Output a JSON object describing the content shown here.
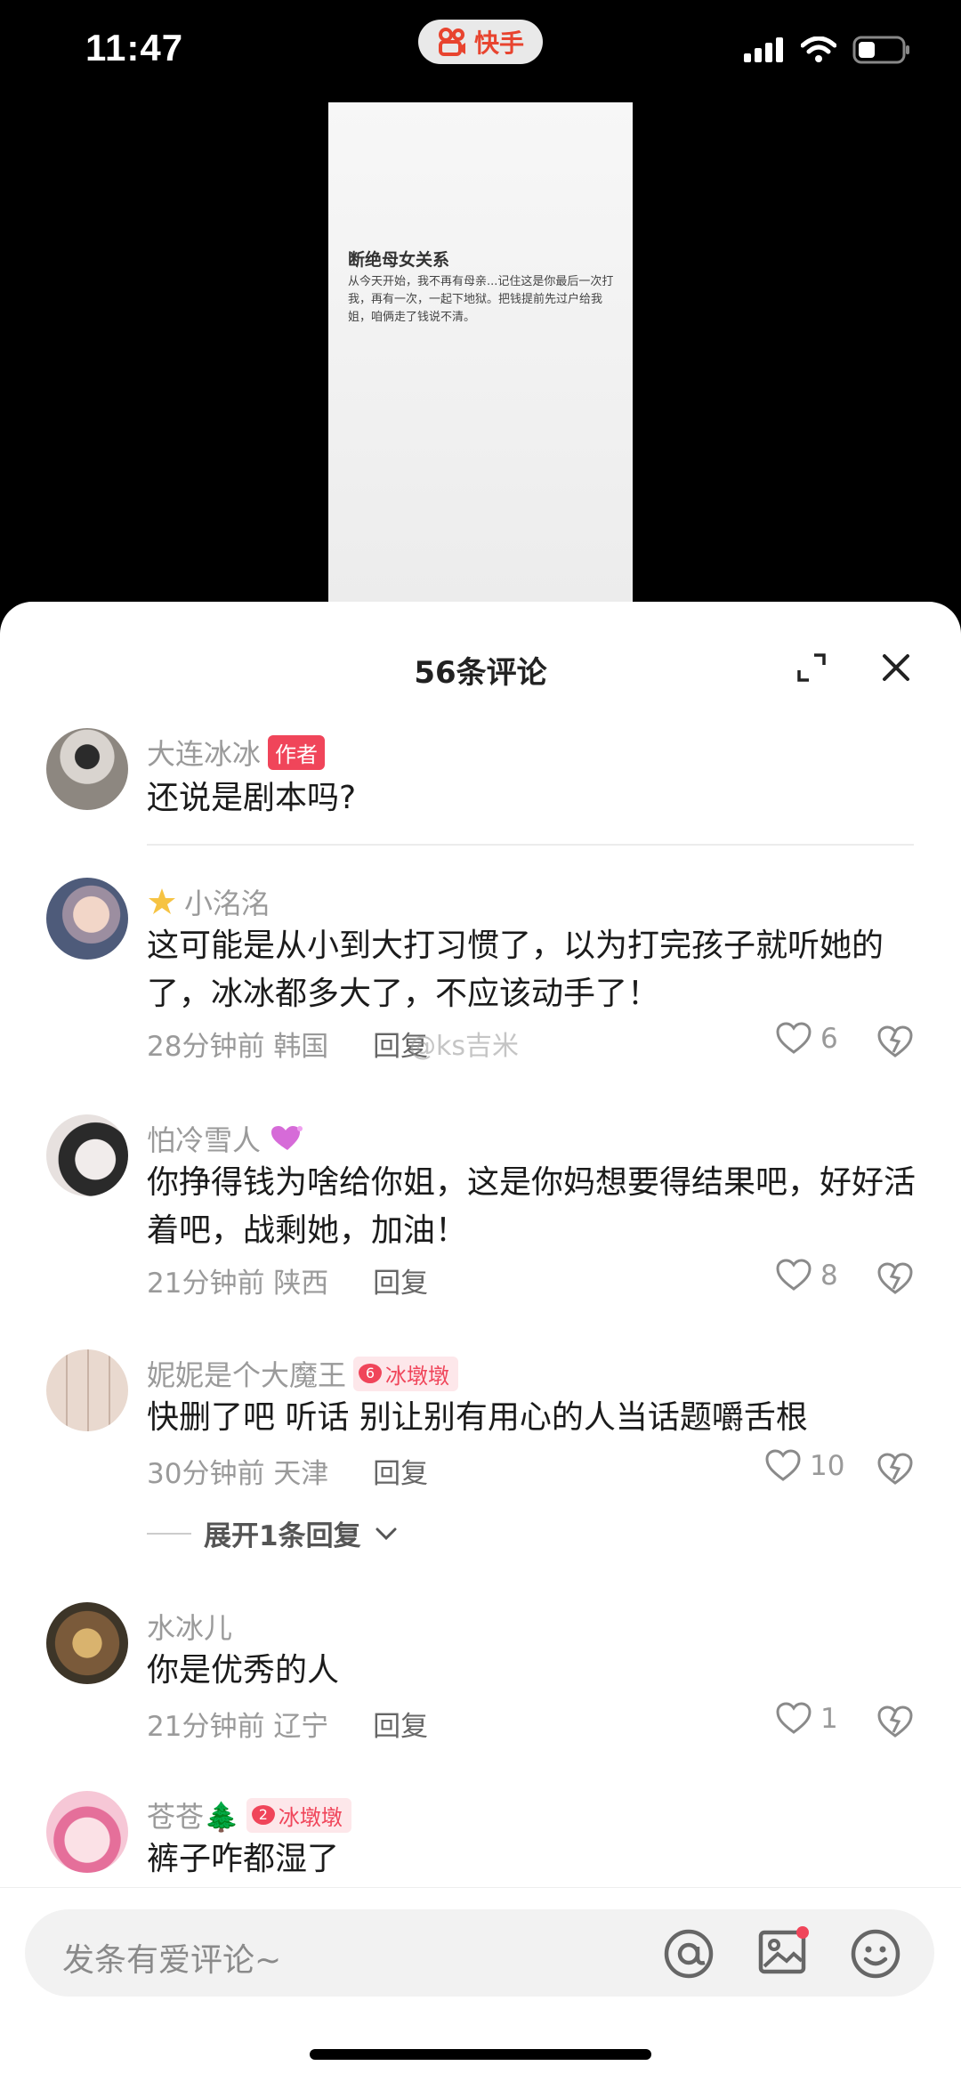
{
  "status_bar": {
    "time": "11:47",
    "app_name": "快手",
    "app_color": "#e8442f"
  },
  "photo": {
    "title": "断绝母女关系",
    "body": "从今天开始，我不再有母亲...记住这是你最后一次打我，再有一次，一起下地狱。把钱提前先过户给我姐，咱俩走了钱说不清。"
  },
  "comments_header": {
    "count_label": "56条评论"
  },
  "comments": [
    {
      "name": "大连冰冰",
      "badge": "作者",
      "text": "还说是剧本吗?"
    },
    {
      "name": "小洺洺",
      "text": "这可能是从小到大打习惯了，以为打完孩子就听她的了，冰冰都多大了，不应该动手了！",
      "time": "28分钟前",
      "location": "韩国",
      "reply": "回复",
      "likes": "6"
    },
    {
      "name": "怕冷雪人",
      "text": "你挣得钱为啥给你姐，这是你妈想要得结果吧，好好活着吧，战剩她，加油！",
      "time": "21分钟前",
      "location": "陕西",
      "reply": "回复",
      "likes": "8"
    },
    {
      "name": "妮妮是个大魔王",
      "badge_level": "6",
      "badge": "冰墩墩",
      "text": "快删了吧 听话 别让别有用心的人当话题嚼舌根",
      "time": "30分钟前",
      "location": "天津",
      "reply": "回复",
      "likes": "10",
      "expand": "展开1条回复"
    },
    {
      "name": "水冰儿",
      "text": "你是优秀的人",
      "time": "21分钟前",
      "location": "辽宁",
      "reply": "回复",
      "likes": "1"
    },
    {
      "name": "苍苍🌲",
      "badge_level": "2",
      "badge": "冰墩墩",
      "text": "裤子咋都湿了"
    }
  ],
  "watermark": "@ks吉米",
  "input": {
    "placeholder": "发条有爱评论~"
  },
  "icons": [
    "expand-icon",
    "close-icon",
    "heart-icon",
    "dislike-icon",
    "at-icon",
    "image-icon",
    "emoji-icon"
  ]
}
